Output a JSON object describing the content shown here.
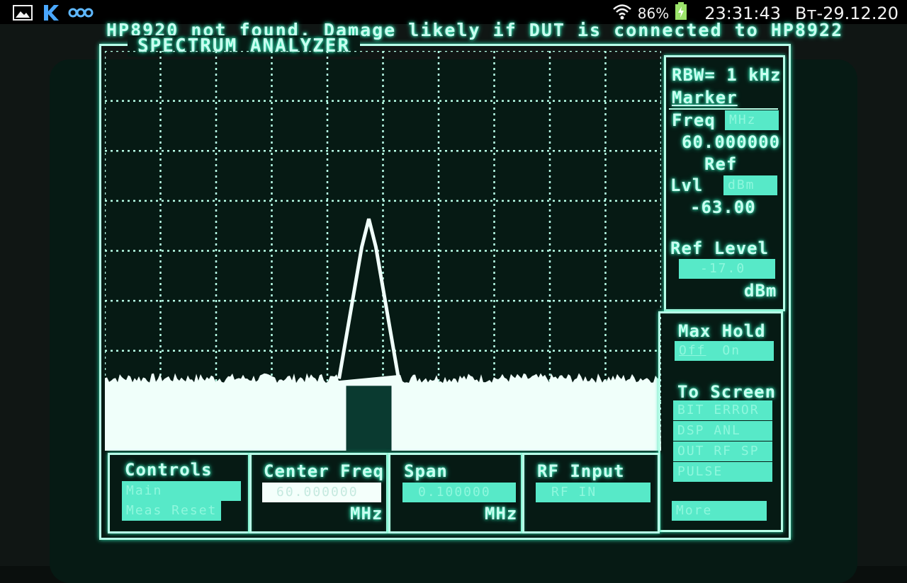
{
  "statusbar": {
    "battery": "86%",
    "time": "23:31:43",
    "date": "Вт-29.12.20",
    "icons": [
      "gallery-icon",
      "k-app-icon",
      "eco-icon",
      "wifi-icon",
      "battery-charging-icon"
    ]
  },
  "screen": {
    "top_message": "HP8920 not found. Damage likely if DUT is connected to HP8922",
    "title": "SPECTRUM ANALYZER",
    "colors": {
      "phosphor": "#c8fff0",
      "field": "#57e9c8",
      "background": "#061a14"
    }
  },
  "right_panel": {
    "rbw": "RBW= 1 kHz",
    "marker_label": "Marker",
    "freq_label": "Freq",
    "freq_unit": "MHz",
    "freq_value": "60.000000",
    "ref_label": "Ref",
    "lvl_label": "Lvl",
    "lvl_unit": "dBm",
    "lvl_value": "-63.00",
    "ref_level_label": "Ref Level",
    "ref_level_value": "-17.0",
    "ref_level_unit": "dBm"
  },
  "right_lower_panel": {
    "max_hold_label": "Max Hold",
    "max_hold_off": "Off",
    "max_hold_on": "On",
    "to_screen_label": "To Screen",
    "to_screen_items": [
      "BIT ERROR",
      "DSP ANL",
      "OUT RF SP",
      "PULSE"
    ],
    "more_label": "More"
  },
  "bottom_panels": {
    "controls": {
      "label": "Controls",
      "options": [
        "Main",
        "Meas Reset"
      ]
    },
    "center_freq": {
      "label": "Center Freq",
      "value": "60.000000",
      "unit": "MHz"
    },
    "span": {
      "label": "Span",
      "value": "0.100000",
      "unit": "MHz"
    },
    "rf_input": {
      "label": "RF Input",
      "value": "RF IN"
    }
  },
  "trace": {
    "grid_columns": 10,
    "grid_rows": 8,
    "peak_position": 0.5,
    "noise_floor_fraction": 0.18,
    "peak_level_fraction": 0.58
  }
}
